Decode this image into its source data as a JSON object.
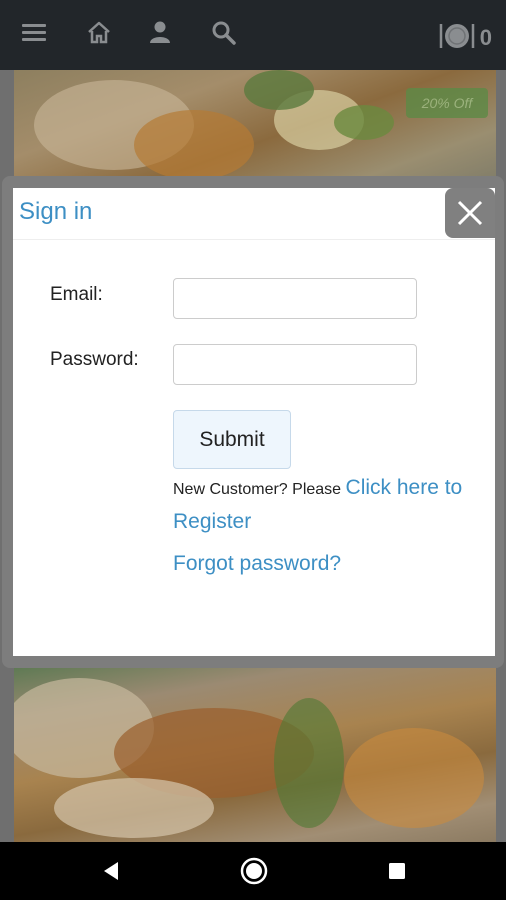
{
  "topbar": {
    "cart_count": "0"
  },
  "promo": {
    "badge": "20% Off"
  },
  "signin_modal": {
    "title": "Sign in",
    "email_label": "Email:",
    "email_value": "",
    "password_label": "Password:",
    "password_value": "",
    "submit_label": "Submit",
    "register_prefix": "New Customer? Please",
    "register_link": "Click here to Register",
    "forgot_link": "Forgot password?"
  },
  "colors": {
    "link": "#3d8fc4",
    "topbar": "#22262a",
    "submit_bg": "#eef6fd"
  },
  "icons": [
    "menu-icon",
    "home-icon",
    "user-icon",
    "search-icon",
    "dining-icon",
    "close-icon",
    "back-icon",
    "home-circle-icon",
    "recent-apps-icon"
  ]
}
